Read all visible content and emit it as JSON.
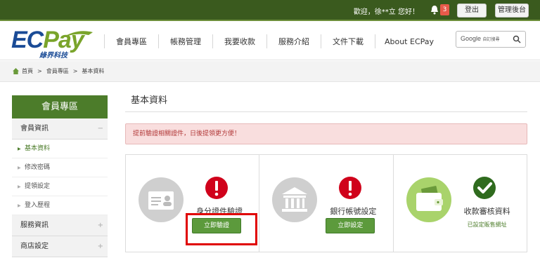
{
  "topbar": {
    "welcome": "歡迎，徐**立 您好！",
    "notification_count": "3",
    "logout_label": "登出",
    "admin_label": "管理後台"
  },
  "logo": {
    "ec": "EC",
    "pay": "Pay",
    "subtitle": "綠界科技"
  },
  "nav": {
    "items": [
      {
        "label": "會員專區"
      },
      {
        "label": "帳務管理"
      },
      {
        "label": "我要收款"
      },
      {
        "label": "服務介紹"
      },
      {
        "label": "文件下載"
      },
      {
        "label": "About ECPay"
      }
    ]
  },
  "search": {
    "label": "Google",
    "suffix": "自訂搜尋"
  },
  "breadcrumb": {
    "home": "首頁",
    "level1": "會員專區",
    "level2": "基本資料",
    "sep": ">"
  },
  "sidebar": {
    "title": "會員專區",
    "sections": [
      {
        "label": "會員資訊",
        "toggle": "−"
      },
      {
        "label": "服務資訊",
        "toggle": "+"
      },
      {
        "label": "商店設定",
        "toggle": "+"
      }
    ],
    "sub_items": [
      {
        "label": "基本資料"
      },
      {
        "label": "修改密碼"
      },
      {
        "label": "提領設定"
      },
      {
        "label": "登入歷程"
      }
    ]
  },
  "main": {
    "title": "基本資料",
    "alert": "提前驗證相關證件，日後提領更方便！",
    "cards": [
      {
        "label": "身分證件驗證",
        "button": "立即驗證",
        "status": "warning"
      },
      {
        "label": "銀行帳號設定",
        "button": "立即設定",
        "status": "warning"
      },
      {
        "label": "收款審核資料",
        "note": "已設定販售網址",
        "status": "ok"
      }
    ]
  },
  "colors": {
    "accent_green": "#4c7c2a",
    "alert_red": "#d0021b",
    "topbar": "#3a5a1e"
  }
}
